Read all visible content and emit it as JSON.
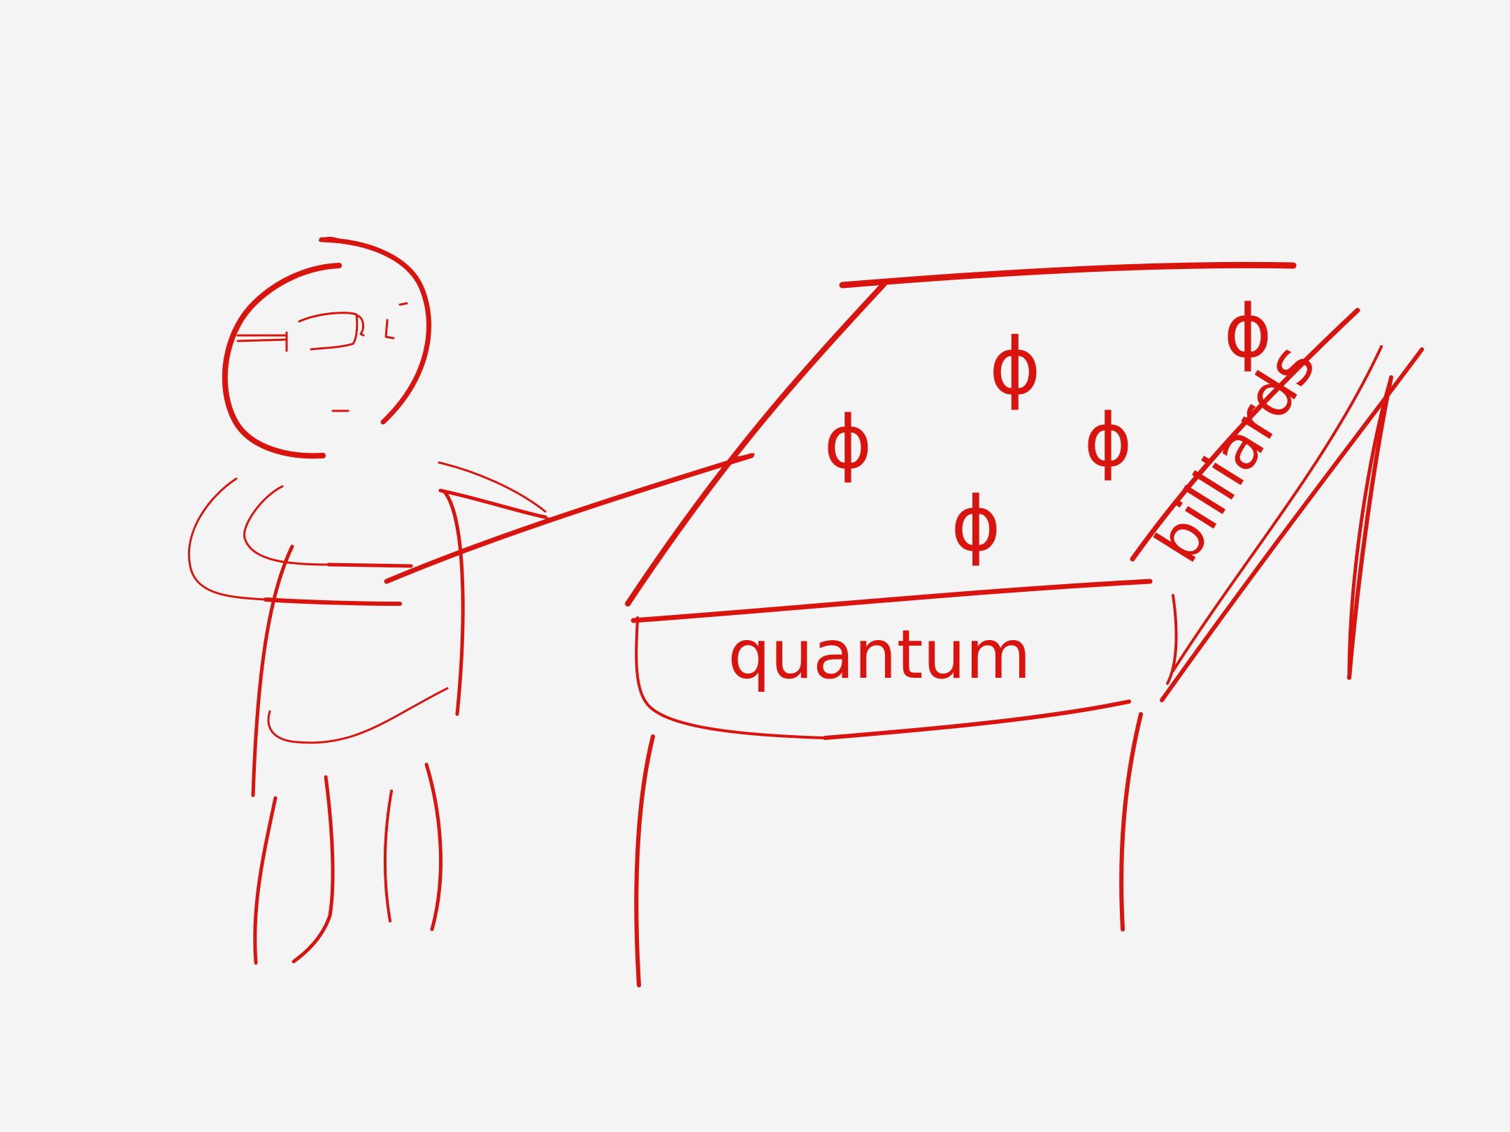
{
  "ink_color": "#d9140e",
  "paper_color": "#f4f4f4",
  "table_front_label": "quantum",
  "table_side_label": "billiards",
  "ball_symbol": "ϕ",
  "figure": {
    "subject": "person-with-glasses-holding-cue-stick"
  }
}
